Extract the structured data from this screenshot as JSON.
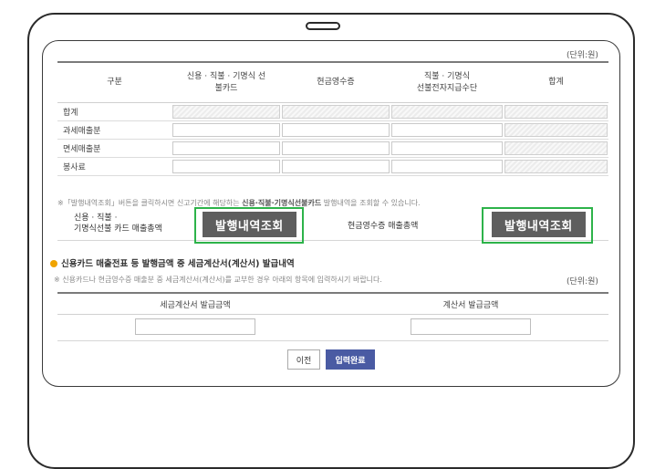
{
  "unit_label": "(단위:원)",
  "table": {
    "headers": [
      "구분",
      "신용 · 직불 · 기명식 선\n불카드",
      "현금영수증",
      "직불 · 기명식\n선불전자지급수단",
      "합계"
    ],
    "rows": [
      {
        "label": "합계"
      },
      {
        "label": "과세매출분"
      },
      {
        "label": "면세매출분"
      },
      {
        "label": "봉사료"
      }
    ]
  },
  "notice": {
    "prefix": "※「발행내역조회」버튼을 클릭하시면 신고기간에 해당하는 ",
    "bold": "신용·직불·기명식선불카드",
    "suffix": " 발행내역을 조회할 수 있습니다."
  },
  "issue_row": {
    "card_label_line1": "신용 · 직불 ·",
    "card_label_line2": "기명식선불 카드 매출총액",
    "card_button": "발행내역조회",
    "cash_label": "현금영수증 매출총액",
    "cash_button": "발행내역조회"
  },
  "section2": {
    "title": "신용카드 매출전표 등 발행금액 중 세금계산서(계산서) 발급내역",
    "note": "※ 신용카드나 현금영수증 매출분 중 세금계산서(계산서)를 교부한 경우 아래의 항목에 입력하시기 바랍니다.",
    "unit_label": "(단위:원)",
    "headers": [
      "세금계산서 발급금액",
      "계산서 발급금액"
    ]
  },
  "buttons": {
    "prev": "이전",
    "done": "입력완료"
  },
  "colors": {
    "highlight": "#2db34a",
    "primary": "#4a5ba3",
    "issue_button": "#5e5e5e",
    "bullet": "#f0a400"
  }
}
